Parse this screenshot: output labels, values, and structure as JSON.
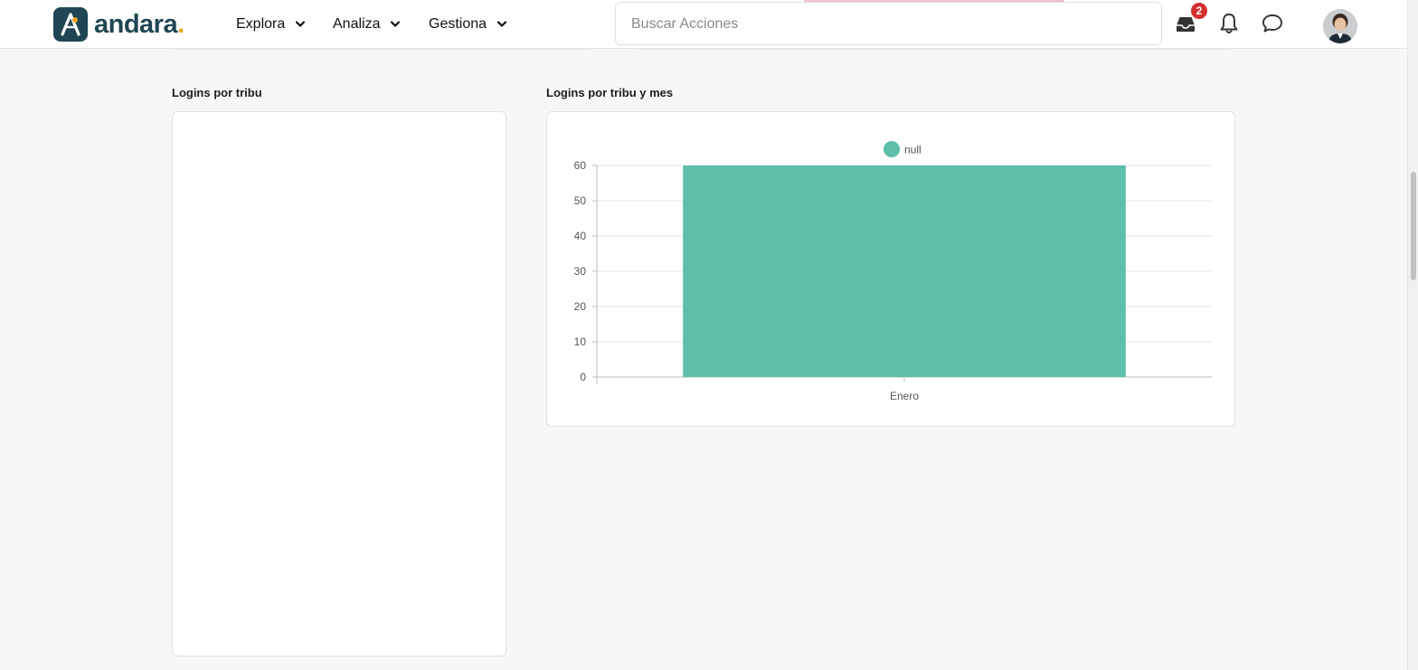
{
  "brand": {
    "name": "andara",
    "dot": "."
  },
  "nav": [
    {
      "label": "Explora"
    },
    {
      "label": "Analiza"
    },
    {
      "label": "Gestiona"
    }
  ],
  "search": {
    "placeholder": "Buscar Acciones",
    "value": ""
  },
  "header_icons": {
    "inbox": "inbox-icon",
    "notifications": "bell-icon",
    "messages": "chat-bubble-icon",
    "inbox_badge": "2"
  },
  "panels": {
    "left": {
      "title": "Logins por tribu"
    },
    "right": {
      "title": "Logins por tribu y mes"
    }
  },
  "colors": {
    "brand_dark": "#1f4652",
    "brand_accent": "#f0a21c",
    "bar": "#5bbfaa",
    "badge": "#d62f2f"
  },
  "chart_data": {
    "type": "bar",
    "categories": [
      "Enero"
    ],
    "series": [
      {
        "name": "null",
        "values": [
          60
        ]
      }
    ],
    "ylim": [
      0,
      60
    ],
    "yticks": [
      0,
      10,
      20,
      30,
      40,
      50,
      60
    ],
    "legend": "top-center",
    "grid": true
  }
}
